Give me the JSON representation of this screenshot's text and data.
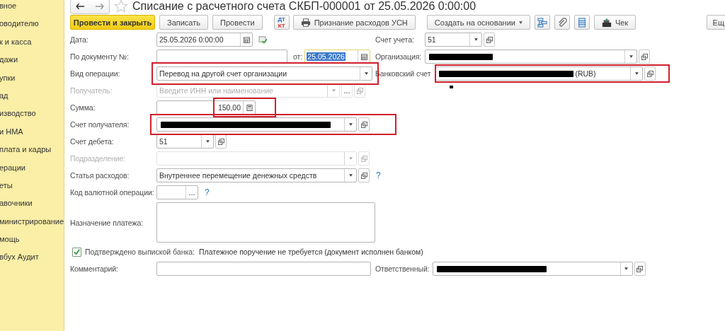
{
  "sidebar": {
    "items": [
      {
        "label": "вное"
      },
      {
        "label": "оводителю"
      },
      {
        "label": "к и касса"
      },
      {
        "label": "дажи"
      },
      {
        "label": "упки"
      },
      {
        "label": "ад"
      },
      {
        "label": "изводство"
      },
      {
        "label": "и НМА"
      },
      {
        "label": "плата и кадры"
      },
      {
        "label": "ерации"
      },
      {
        "label": "еты"
      },
      {
        "label": "авочники"
      },
      {
        "label": "министрирование"
      },
      {
        "label": "мощь"
      },
      {
        "label": "вбух Аудит"
      }
    ]
  },
  "header": {
    "title": "Списание с расчетного счета СКБП-000001 от 25.05.2026 0:00:00"
  },
  "toolbar": {
    "buttons": [
      {
        "kind": "primary",
        "label": "Провести и закрыть"
      },
      {
        "kind": "plain",
        "label": "Записать"
      },
      {
        "kind": "plain",
        "label": "Провести"
      },
      {
        "kind": "dtkt",
        "label": "ДТ",
        "label2": "КТ"
      },
      {
        "kind": "print",
        "label": "Признание расходов УСН"
      },
      {
        "kind": "menu",
        "label": "Создать на основании"
      },
      {
        "kind": "structure"
      },
      {
        "kind": "clip"
      },
      {
        "kind": "list"
      },
      {
        "kind": "receipt",
        "label": "Чек"
      },
      {
        "kind": "more",
        "label": "Ещ"
      }
    ]
  },
  "fields": {
    "date": {
      "label": "Дата:",
      "value": "25.05.2026  0:00:00"
    },
    "account": {
      "label": "Счет учета:",
      "value": "51"
    },
    "doc_number": {
      "label": "По документу №:"
    },
    "doc_date": {
      "label": "от:",
      "value": "25.05.2026",
      "selected": true
    },
    "organization": {
      "label": "Организация:",
      "redacted": true
    },
    "operation": {
      "label": "Вид операции:",
      "value": "Перевод на другой счет организации",
      "highlighted": true
    },
    "bank_account": {
      "label": "Банковский счет",
      "value": "(RUB)",
      "redacted": true,
      "highlighted": true
    },
    "recipient": {
      "label": "Получатель:",
      "placeholder": "Введите ИНН или наименование",
      "select_button": "...",
      "disabled": true
    },
    "amount": {
      "label": "Сумма:",
      "value": "150,00",
      "highlighted": true
    },
    "recipient_account": {
      "label": "Счет получателя:",
      "redacted": true,
      "highlighted": true
    },
    "debit_account": {
      "label": "Счет дебета:",
      "value": "51"
    },
    "department": {
      "label": "Подразделение:",
      "disabled": true
    },
    "expense_item": {
      "label": "Статья расходов:",
      "value": "Внутреннее перемещение денежных средств",
      "help": "?"
    },
    "currency_code": {
      "label": "Код валютной операции:",
      "select_button": "...",
      "help": "?"
    },
    "purpose": {
      "label": "Назначение платежа:"
    },
    "confirmed": {
      "label": "Подтверждено выпиской банка:",
      "checked": true,
      "note": "Платежное поручение не требуется (документ исполнен банком)"
    },
    "comment": {
      "label": "Комментарий:"
    },
    "responsible": {
      "label": "Ответственный:",
      "redacted": true
    }
  }
}
